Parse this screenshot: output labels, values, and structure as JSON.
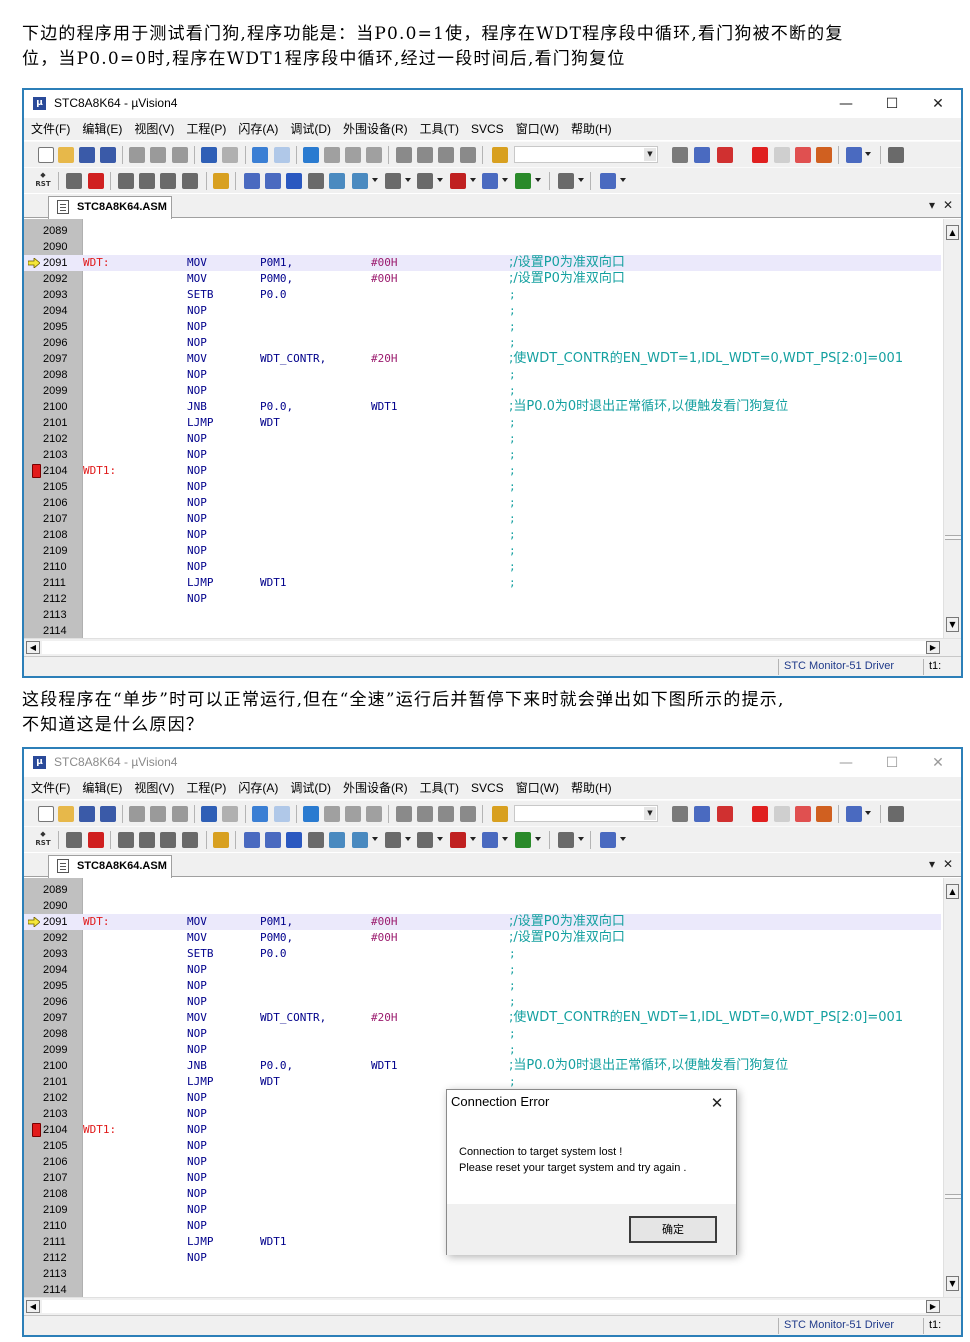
{
  "intro": {
    "line1": "下边的程序用于测试看门狗,程序功能是：当P0.0=1使，程序在WDT程序段中循环,看门狗被不断的复",
    "line2": "位，当P0.0=0时,程序在WDT1程序段中循环,经过一段时间后,看门狗复位"
  },
  "question": {
    "line1": "这段程序在“单步”时可以正常运行,但在“全速”运行后并暂停下来时就会弹出如下图所示的提示,",
    "line2": "不知道这是什么原因？"
  },
  "window": {
    "title": "STC8A8K64  - µVision4",
    "app_icon": "μ",
    "controls": {
      "minimize": "—",
      "maximize": "☐",
      "close": "✕"
    },
    "menu": [
      "文件(F)",
      "编辑(E)",
      "视图(V)",
      "工程(P)",
      "闪存(A)",
      "调试(D)",
      "外围设备(R)",
      "工具(T)",
      "SVCS",
      "窗口(W)",
      "帮助(H)"
    ],
    "tab_label": "STC8A8K64.ASM",
    "tab_controls": {
      "dropdown": "▾",
      "close": "✕"
    },
    "status_driver": "STC Monitor-51 Driver",
    "status_t1": "t1:"
  },
  "code": {
    "lines": [
      {
        "ln": "2089",
        "label": "",
        "op": "",
        "a1": "",
        "a2": "",
        "cmt": ""
      },
      {
        "ln": "2090",
        "label": "",
        "op": "",
        "a1": "",
        "a2": "",
        "cmt": ""
      },
      {
        "ln": "2091",
        "label": "WDT:",
        "op": "MOV",
        "a1": "P0M1,",
        "a2": "#00H",
        "cmt": ";/设置P0为准双向口"
      },
      {
        "ln": "2092",
        "label": "",
        "op": "MOV",
        "a1": "P0M0,",
        "a2": "#00H",
        "cmt": ";/设置P0为准双向口"
      },
      {
        "ln": "2093",
        "label": "",
        "op": "SETB",
        "a1": "P0.0",
        "a2": "",
        "cmt": ";"
      },
      {
        "ln": "2094",
        "label": "",
        "op": "NOP",
        "a1": "",
        "a2": "",
        "cmt": ";"
      },
      {
        "ln": "2095",
        "label": "",
        "op": "NOP",
        "a1": "",
        "a2": "",
        "cmt": ";"
      },
      {
        "ln": "2096",
        "label": "",
        "op": "NOP",
        "a1": "",
        "a2": "",
        "cmt": ";"
      },
      {
        "ln": "2097",
        "label": "",
        "op": "MOV",
        "a1": "WDT_CONTR,",
        "a2": "#20H",
        "cmt": ";使WDT_CONTR的EN_WDT=1,IDL_WDT=0,WDT_PS[2:0]=001"
      },
      {
        "ln": "2098",
        "label": "",
        "op": "NOP",
        "a1": "",
        "a2": "",
        "cmt": ";"
      },
      {
        "ln": "2099",
        "label": "",
        "op": "NOP",
        "a1": "",
        "a2": "",
        "cmt": ";"
      },
      {
        "ln": "2100",
        "label": "",
        "op": "JNB",
        "a1": "P0.0,",
        "a2": "WDT1",
        "cmt": ";当P0.0为0时退出正常循环,以便触发看门狗复位"
      },
      {
        "ln": "2101",
        "label": "",
        "op": "LJMP",
        "a1": "WDT",
        "a2": "",
        "cmt": ";"
      },
      {
        "ln": "2102",
        "label": "",
        "op": "NOP",
        "a1": "",
        "a2": "",
        "cmt": ";"
      },
      {
        "ln": "2103",
        "label": "",
        "op": "NOP",
        "a1": "",
        "a2": "",
        "cmt": ";"
      },
      {
        "ln": "2104",
        "label": "WDT1:",
        "op": "NOP",
        "a1": "",
        "a2": "",
        "cmt": ";"
      },
      {
        "ln": "2105",
        "label": "",
        "op": "NOP",
        "a1": "",
        "a2": "",
        "cmt": ";"
      },
      {
        "ln": "2106",
        "label": "",
        "op": "NOP",
        "a1": "",
        "a2": "",
        "cmt": ";"
      },
      {
        "ln": "2107",
        "label": "",
        "op": "NOP",
        "a1": "",
        "a2": "",
        "cmt": ";"
      },
      {
        "ln": "2108",
        "label": "",
        "op": "NOP",
        "a1": "",
        "a2": "",
        "cmt": ";"
      },
      {
        "ln": "2109",
        "label": "",
        "op": "NOP",
        "a1": "",
        "a2": "",
        "cmt": ";"
      },
      {
        "ln": "2110",
        "label": "",
        "op": "NOP",
        "a1": "",
        "a2": "",
        "cmt": ";"
      },
      {
        "ln": "2111",
        "label": "",
        "op": "LJMP",
        "a1": "WDT1",
        "a2": "",
        "cmt": ";"
      },
      {
        "ln": "2112",
        "label": "",
        "op": "NOP",
        "a1": "",
        "a2": "",
        "cmt": ""
      },
      {
        "ln": "2113",
        "label": "",
        "op": "",
        "a1": "",
        "a2": "",
        "cmt": ""
      },
      {
        "ln": "2114",
        "label": "",
        "op": "",
        "a1": "",
        "a2": "",
        "cmt": ""
      }
    ],
    "current_line": "2091",
    "breakpoint_line": "2104"
  },
  "dialog": {
    "title": "Connection Error",
    "close": "✕",
    "message_line1": "Connection to target system lost !",
    "message_line2": "Please reset your target system and try again .",
    "ok_label": "确定"
  },
  "colors": {
    "window_border": "#2c7fb8",
    "label": "#e01a1a",
    "mnemonic": "#00008b",
    "immediate": "#9b1b6e",
    "comment": "#14a0a0",
    "breakpoint": "#e21b1b",
    "current_line_bg": "#ebe9fb",
    "gutter": "#c0c0c0"
  }
}
